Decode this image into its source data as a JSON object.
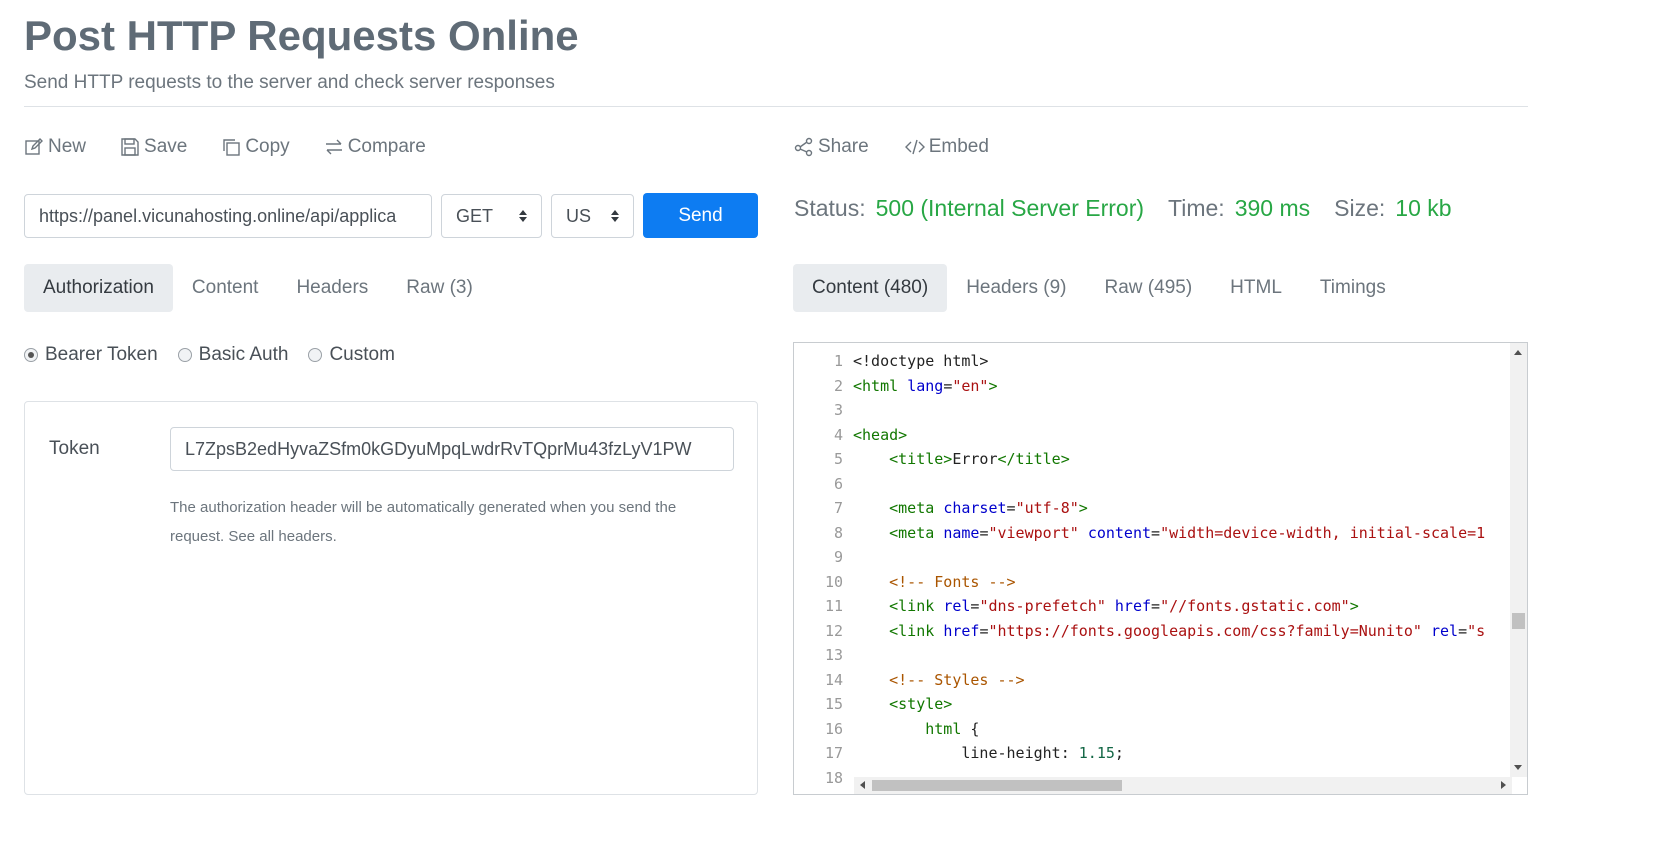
{
  "header": {
    "title": "Post HTTP Requests Online",
    "subtitle": "Send HTTP requests to the server and check server responses"
  },
  "toolbar_left": [
    {
      "label": "New",
      "icon": "edit-icon"
    },
    {
      "label": "Save",
      "icon": "floppy-icon"
    },
    {
      "label": "Copy",
      "icon": "copy-icon"
    },
    {
      "label": "Compare",
      "icon": "compare-icon"
    }
  ],
  "toolbar_right": [
    {
      "label": "Share",
      "icon": "share-icon"
    },
    {
      "label": "Embed",
      "icon": "code-icon"
    }
  ],
  "request": {
    "url": "https://panel.vicunahosting.online/api/applica",
    "method": "GET",
    "region": "US",
    "send_label": "Send"
  },
  "response": {
    "status_label": "Status:",
    "status_value": "500 (Internal Server Error)",
    "time_label": "Time:",
    "time_value": "390 ms",
    "size_label": "Size:",
    "size_value": "10 kb"
  },
  "request_tabs": [
    {
      "label": "Authorization",
      "active": true
    },
    {
      "label": "Content",
      "active": false
    },
    {
      "label": "Headers",
      "active": false
    },
    {
      "label": "Raw (3)",
      "active": false
    }
  ],
  "response_tabs": [
    {
      "label": "Content (480)",
      "active": true
    },
    {
      "label": "Headers (9)",
      "active": false
    },
    {
      "label": "Raw (495)",
      "active": false
    },
    {
      "label": "HTML",
      "active": false
    },
    {
      "label": "Timings",
      "active": false
    }
  ],
  "auth": {
    "options": [
      {
        "label": "Bearer Token",
        "checked": true
      },
      {
        "label": "Basic Auth",
        "checked": false
      },
      {
        "label": "Custom",
        "checked": false
      }
    ],
    "token_label": "Token",
    "token_value": "L7ZpsB2edHyvaZSfm0kGDyuMpqLwdrRvTQprMu43fzLyV1PW",
    "help_text": "The authorization header will be automatically generated when you send the request. See all headers."
  },
  "colors": {
    "accent": "#0d7cf2",
    "success": "#28a745"
  },
  "code": [
    {
      "n": "1",
      "tokens": [
        [
          "plain",
          "<!doctype html>"
        ]
      ]
    },
    {
      "n": "2",
      "tokens": [
        [
          "tag",
          "<html"
        ],
        [
          "plain",
          " "
        ],
        [
          "attr",
          "lang"
        ],
        [
          "plain",
          "="
        ],
        [
          "str",
          "\"en\""
        ],
        [
          "tag",
          ">"
        ]
      ]
    },
    {
      "n": "3",
      "tokens": []
    },
    {
      "n": "4",
      "tokens": [
        [
          "tag",
          "<head>"
        ]
      ]
    },
    {
      "n": "5",
      "tokens": [
        [
          "plain",
          "    "
        ],
        [
          "tag",
          "<title>"
        ],
        [
          "plain",
          "Error"
        ],
        [
          "tag",
          "</title>"
        ]
      ]
    },
    {
      "n": "6",
      "tokens": []
    },
    {
      "n": "7",
      "tokens": [
        [
          "plain",
          "    "
        ],
        [
          "tag",
          "<meta"
        ],
        [
          "plain",
          " "
        ],
        [
          "attr",
          "charset"
        ],
        [
          "plain",
          "="
        ],
        [
          "str",
          "\"utf-8\""
        ],
        [
          "tag",
          ">"
        ]
      ]
    },
    {
      "n": "8",
      "tokens": [
        [
          "plain",
          "    "
        ],
        [
          "tag",
          "<meta"
        ],
        [
          "plain",
          " "
        ],
        [
          "attr",
          "name"
        ],
        [
          "plain",
          "="
        ],
        [
          "str",
          "\"viewport\""
        ],
        [
          "plain",
          " "
        ],
        [
          "attr",
          "content"
        ],
        [
          "plain",
          "="
        ],
        [
          "str",
          "\"width=device-width, initial-scale=1"
        ]
      ]
    },
    {
      "n": "9",
      "tokens": []
    },
    {
      "n": "10",
      "tokens": [
        [
          "plain",
          "    "
        ],
        [
          "cmt",
          "<!-- Fonts -->"
        ]
      ]
    },
    {
      "n": "11",
      "tokens": [
        [
          "plain",
          "    "
        ],
        [
          "tag",
          "<link"
        ],
        [
          "plain",
          " "
        ],
        [
          "attr",
          "rel"
        ],
        [
          "plain",
          "="
        ],
        [
          "str",
          "\"dns-prefetch\""
        ],
        [
          "plain",
          " "
        ],
        [
          "attr",
          "href"
        ],
        [
          "plain",
          "="
        ],
        [
          "str",
          "\"//fonts.gstatic.com\""
        ],
        [
          "tag",
          ">"
        ]
      ]
    },
    {
      "n": "12",
      "tokens": [
        [
          "plain",
          "    "
        ],
        [
          "tag",
          "<link"
        ],
        [
          "plain",
          " "
        ],
        [
          "attr",
          "href"
        ],
        [
          "plain",
          "="
        ],
        [
          "str",
          "\"https://fonts.googleapis.com/css?family=Nunito\""
        ],
        [
          "plain",
          " "
        ],
        [
          "attr",
          "rel"
        ],
        [
          "plain",
          "="
        ],
        [
          "str",
          "\"s"
        ]
      ]
    },
    {
      "n": "13",
      "tokens": []
    },
    {
      "n": "14",
      "tokens": [
        [
          "plain",
          "    "
        ],
        [
          "cmt",
          "<!-- Styles -->"
        ]
      ]
    },
    {
      "n": "15",
      "tokens": [
        [
          "plain",
          "    "
        ],
        [
          "tag",
          "<style>"
        ]
      ]
    },
    {
      "n": "16",
      "tokens": [
        [
          "plain",
          "        "
        ],
        [
          "tag",
          "html"
        ],
        [
          "plain",
          " {"
        ]
      ]
    },
    {
      "n": "17",
      "tokens": [
        [
          "plain",
          "            line-height: "
        ],
        [
          "num",
          "1.15"
        ],
        [
          "plain",
          ";"
        ]
      ]
    },
    {
      "n": "18",
      "tokens": []
    }
  ]
}
